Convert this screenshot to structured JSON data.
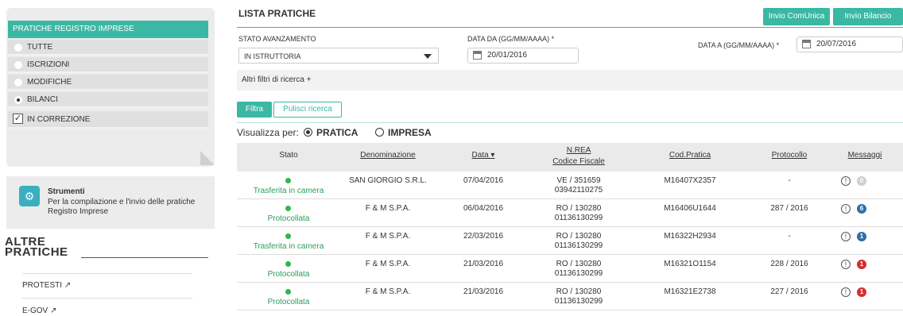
{
  "sidebar": {
    "filter_title": "PRATICHE REGISTRO IMPRESE",
    "options": [
      "TUTTE",
      "ISCRIZIONI",
      "MODIFICHE",
      "BILANCI"
    ],
    "selected_option": "BILANCI",
    "checkbox_label": "IN CORREZIONE",
    "tools_title": "Strumenti",
    "tools_desc": "Per la compilazione e l'invio delle pratiche Registro Imprese",
    "altre_line1": "ALTRE",
    "altre_line2": "PRATICHE",
    "links": [
      "PROTESTI",
      "E-GOV"
    ]
  },
  "main": {
    "title": "LISTA PRATICHE",
    "btn_comunica": "Invio ComUnica",
    "btn_bilancio": "Invio Bilancio",
    "stato_label": "STATO AVANZAMENTO",
    "stato_value": "IN ISTRUTTORIA",
    "data_da_label": "DATA DA (GG/MM/AAAA) *",
    "data_da_value": "20/01/2016",
    "data_a_label": "DATA A (GG/MM/AAAA) *",
    "data_a_value": "20/07/2016",
    "altri_filtri": "Altri filtri di ricerca +",
    "btn_filtra": "Filtra",
    "btn_pulisci": "Pulisci ricerca",
    "visualizza": "Visualizza per:",
    "viz_pratica": "PRATICA",
    "viz_impresa": "IMPRESA"
  },
  "table": {
    "headers": {
      "stato": "Stato",
      "denominazione": "Denominazione",
      "data": "Data ▾",
      "nrea": "N.REA",
      "cf": "Codice Fiscale",
      "cod": "Cod.Pratica",
      "protocollo": "Protocollo",
      "messaggi": "Messaggi"
    },
    "rows": [
      {
        "stato": "Trasferita in camera",
        "den": "SAN GIORGIO S.R.L.",
        "data": "07/04/2016",
        "nrea": "VE / 351659",
        "cf": "03942110275",
        "cod": "M16407X2357",
        "prot": "-",
        "badge": "0",
        "badge_color": "#cfcfcf"
      },
      {
        "stato": "Protocollata",
        "den": "F & M S.P.A.",
        "data": "06/04/2016",
        "nrea": "RO / 130280",
        "cf": "01136130299",
        "cod": "M16406U1644",
        "prot": "287 / 2016",
        "badge": "6",
        "badge_color": "#2f6fa6"
      },
      {
        "stato": "Trasferita in camera",
        "den": "F & M S.P.A.",
        "data": "22/03/2016",
        "nrea": "RO / 130280",
        "cf": "01136130299",
        "cod": "M16322H2934",
        "prot": "-",
        "badge": "1",
        "badge_color": "#2f6fa6"
      },
      {
        "stato": "Protocollata",
        "den": "F & M S.P.A.",
        "data": "21/03/2016",
        "nrea": "RO / 130280",
        "cf": "01136130299",
        "cod": "M16321O1154",
        "prot": "228 / 2016",
        "badge": "1",
        "badge_color": "#d32f2f"
      },
      {
        "stato": "Protocollata",
        "den": "F & M S.P.A.",
        "data": "21/03/2016",
        "nrea": "RO / 130280",
        "cf": "01136130299",
        "cod": "M16321E2738",
        "prot": "227 / 2016",
        "badge": "1",
        "badge_color": "#d32f2f"
      }
    ]
  }
}
